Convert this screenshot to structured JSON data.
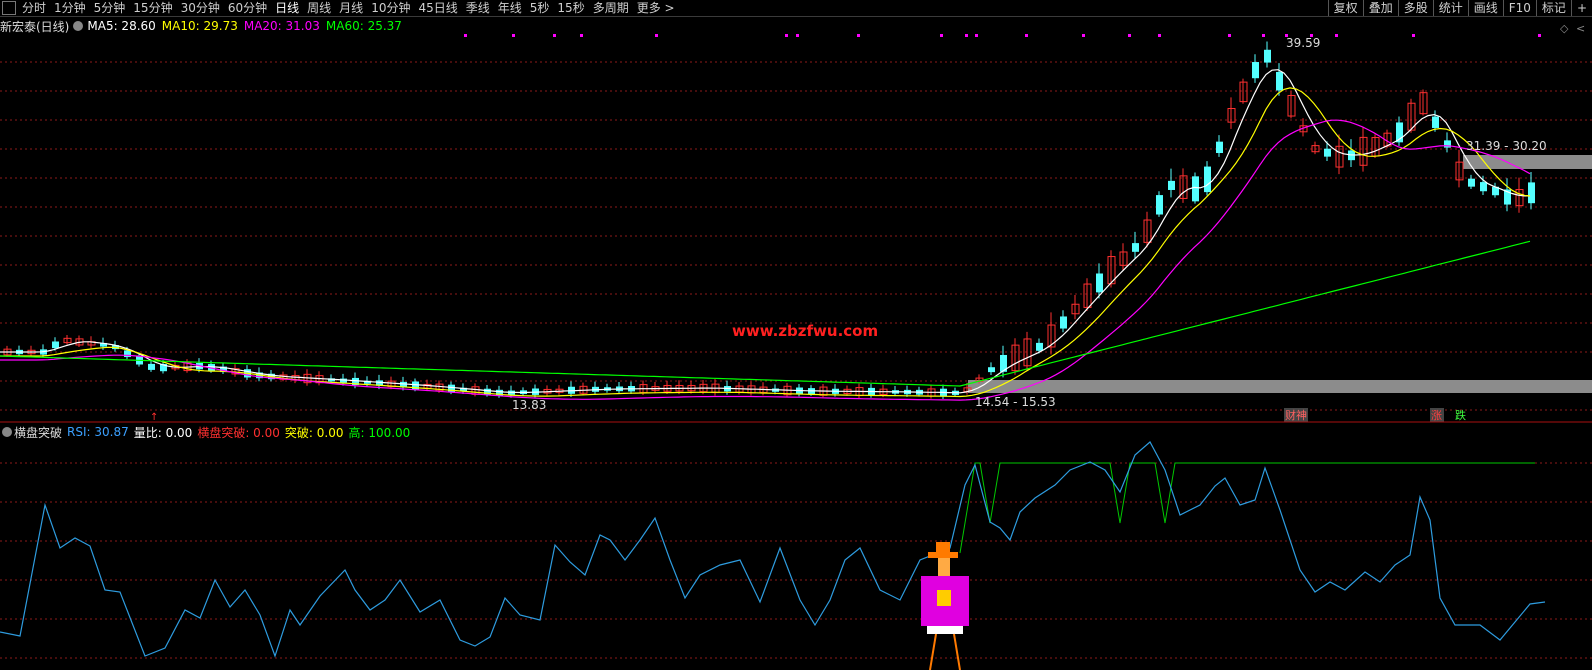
{
  "toolbar": {
    "periods": [
      "分时",
      "1分钟",
      "5分钟",
      "15分钟",
      "30分钟",
      "60分钟",
      "日线",
      "周线",
      "月线",
      "10分钟",
      "45日线",
      "季线",
      "年线",
      "5秒",
      "15秒",
      "多周期",
      "更多 >"
    ],
    "active_period": "日线",
    "right_tools": [
      "复权",
      "叠加",
      "多股",
      "统计",
      "画线",
      "F10",
      "标记",
      "+"
    ]
  },
  "stock": {
    "name": "新宏泰(日线)",
    "ma": [
      {
        "label": "MA5: 28.60",
        "color": "#ffffff"
      },
      {
        "label": "MA10: 29.73",
        "color": "#ffff00"
      },
      {
        "label": "MA20: 31.03",
        "color": "#ff00ff"
      },
      {
        "label": "MA60: 25.37",
        "color": "#00ff00"
      }
    ]
  },
  "price_chart": {
    "high_label": "39.59",
    "low_label": "13.83",
    "band_low_label": "14.54 - 15.53",
    "band_high_label": "31.39 - 30.20",
    "watermark": "www.zbzfwu.com",
    "markers": {
      "caixi": "财神",
      "zhang": "涨",
      "die": "跌"
    }
  },
  "indicator": {
    "name": "横盘突破",
    "items": [
      {
        "label": "RSI: 30.87",
        "color": "#3ba0ff"
      },
      {
        "label": "量比: 0.00",
        "color": "#ffffff"
      },
      {
        "label": "横盘突破: 0.00",
        "color": "#ff3030"
      },
      {
        "label": "突破: 0.00",
        "color": "#ffff00"
      },
      {
        "label": "高: 100.00",
        "color": "#00ff00"
      }
    ],
    "high_level": 100
  },
  "colors": {
    "up": "#ff3030",
    "down": "#54ffff",
    "ma5": "#ffffff",
    "ma10": "#ffff00",
    "ma20": "#ff00ff",
    "ma60": "#00ff00",
    "rsi": "#2e9cdf",
    "grid": "#8b1a1a",
    "band": "#8c8c8c",
    "pink_dots": "#ff00ff"
  }
}
